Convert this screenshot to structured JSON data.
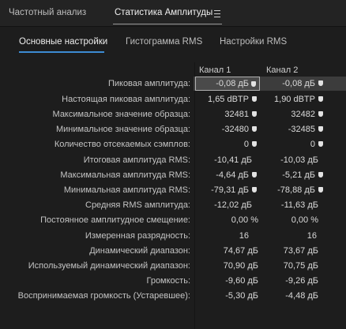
{
  "panel_tabs": {
    "frequency": "Частотный анализ",
    "amplitude": "Статистика Амплитуды"
  },
  "sub_tabs": {
    "basic": "Основные настройки",
    "histogram": "Гистограмма RMS",
    "rms_settings": "Настройки RMS"
  },
  "columns": {
    "ch1": "Канал 1",
    "ch2": "Канал 2"
  },
  "rows": [
    {
      "label": "Пиковая амплитуда:",
      "ch1": "-0,08 дБ",
      "ch2": "-0,08 дБ"
    },
    {
      "label": "Настоящая пиковая амплитуда:",
      "ch1": "1,65 dBTP",
      "ch2": "1,90 dBTP"
    },
    {
      "label": "Максимальное значение образца:",
      "ch1": "32481",
      "ch2": "32482"
    },
    {
      "label": "Минимальное значение образца:",
      "ch1": "-32480",
      "ch2": "-32485"
    },
    {
      "label": "Количество отсекаемых сэмплов:",
      "ch1": "0",
      "ch2": "0"
    },
    {
      "label": "Итоговая амплитуда RMS:",
      "ch1": "-10,41 дБ",
      "ch2": "-10,03 дБ"
    },
    {
      "label": "Максимальная амплитуда RMS:",
      "ch1": "-4,64 дБ",
      "ch2": "-5,21 дБ"
    },
    {
      "label": "Минимальная амплитуда RMS:",
      "ch1": "-79,31 дБ",
      "ch2": "-78,88 дБ"
    },
    {
      "label": "Средняя RMS амплитуда:",
      "ch1": "-12,02 дБ",
      "ch2": "-11,63 дБ"
    },
    {
      "label": "Постоянное амплитудное смещение:",
      "ch1": "0,00 %",
      "ch2": "0,00 %"
    },
    {
      "label": "Измеренная разрядность:",
      "ch1": "16",
      "ch2": "16"
    },
    {
      "label": "Динамический диапазон:",
      "ch1": "74,67 дБ",
      "ch2": "73,67 дБ"
    },
    {
      "label": "Используемый динамический диапазон:",
      "ch1": "70,90 дБ",
      "ch2": "70,75 дБ"
    },
    {
      "label": "Громкость:",
      "ch1": "-9,60 дБ",
      "ch2": "-9,26 дБ"
    },
    {
      "label": "Воспринимаемая громкость (Устаревшее):",
      "ch1": "-5,30 дБ",
      "ch2": "-4,48 дБ"
    }
  ]
}
